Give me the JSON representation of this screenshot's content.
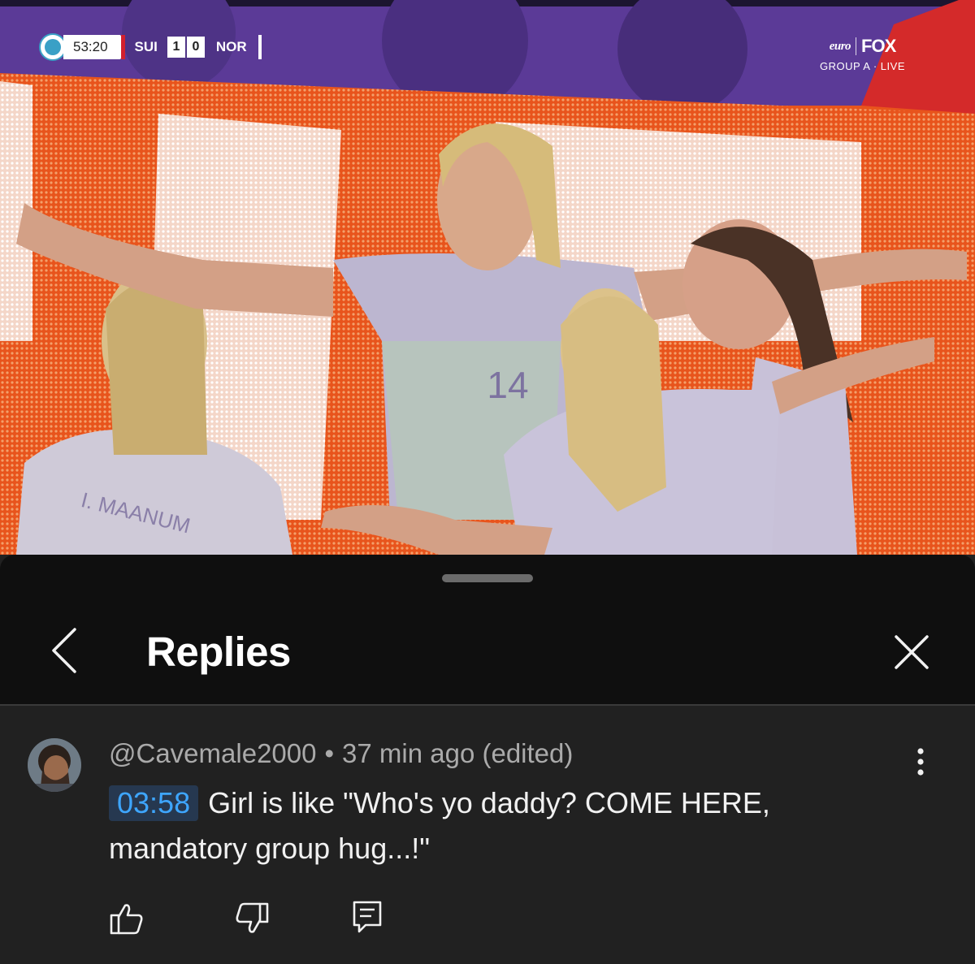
{
  "video": {
    "scoreboard": {
      "clock": "53:20",
      "home_team": "SUI",
      "home_score": "1",
      "away_score": "0",
      "away_team": "NOR"
    },
    "broadcaster": {
      "tournament_logo": "euro",
      "network": "FOX",
      "status": "GROUP A · LIVE"
    },
    "jersey_number": "14",
    "jersey_name": "I. MAANUM"
  },
  "sheet": {
    "title": "Replies"
  },
  "comment": {
    "author": "@Cavemale2000",
    "separator": "•",
    "time": "37 min ago (edited)",
    "timestamp_link": "03:58",
    "text": "Girl is like \"Who's yo daddy? COME HERE, mandatory group hug...!\""
  },
  "icons": {
    "back": "chevron-left-icon",
    "close": "close-icon",
    "menu": "more-vert-icon",
    "like": "thumb-up-icon",
    "dislike": "thumb-down-icon",
    "reply": "comment-icon"
  },
  "colors": {
    "sheet_bg": "#212121",
    "header_bg": "#0f0f0f",
    "link_blue": "#3ea6ff",
    "timestamp_bg": "#263850",
    "meta_gray": "#aaaaaa"
  }
}
